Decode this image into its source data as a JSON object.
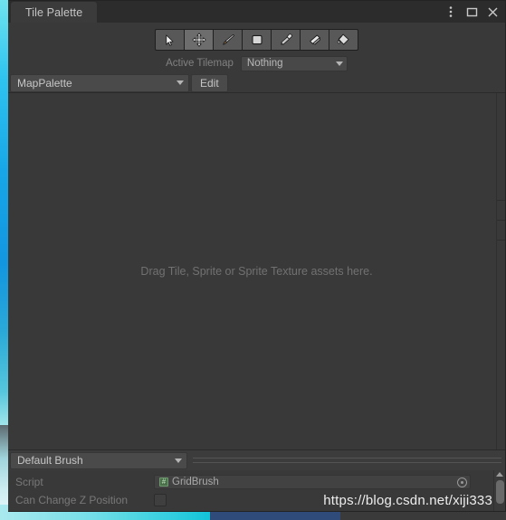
{
  "window": {
    "tab_label": "Tile Palette",
    "controls": [
      {
        "name": "more-menu-icon",
        "glyph": "kebab"
      },
      {
        "name": "maximize-icon",
        "glyph": "square"
      },
      {
        "name": "close-icon",
        "glyph": "cross"
      }
    ]
  },
  "toolbar": {
    "tools": [
      {
        "name": "select-tool",
        "label": "Select",
        "selected": false
      },
      {
        "name": "move-tool",
        "label": "Move",
        "selected": true
      },
      {
        "name": "paint-brush-tool",
        "label": "Paint",
        "selected": false
      },
      {
        "name": "box-fill-tool",
        "label": "Box Fill",
        "selected": false
      },
      {
        "name": "picker-tool",
        "label": "Picker",
        "selected": false
      },
      {
        "name": "eraser-tool",
        "label": "Erase",
        "selected": false
      },
      {
        "name": "fill-tool",
        "label": "Fill",
        "selected": false
      }
    ]
  },
  "active_tilemap": {
    "label": "Active Tilemap",
    "value": "Nothing"
  },
  "palette": {
    "value": "MapPalette",
    "edit_label": "Edit"
  },
  "canvas": {
    "drop_hint": "Drag Tile, Sprite or Sprite Texture assets here."
  },
  "brush": {
    "value": "Default Brush",
    "script_label": "Script",
    "script_value": "GridBrush",
    "script_icon_glyph": "#",
    "z_position_label": "Can Change Z Position",
    "z_position_checked": false
  },
  "watermark": {
    "text": "https://blog.csdn.net/xiji333"
  },
  "colors": {
    "window_bg": "#393939",
    "titlebar_bg": "#2c2c2c",
    "tab_bg": "#3b3b3b",
    "panel_bg": "#3c3c3c",
    "control_bg": "#4a4a4a",
    "tool_bg": "#585858",
    "tool_selected_bg": "#6d6d6d",
    "text": "#c4c4c4",
    "text_disabled": "#787878",
    "accent_cyan": "#2fc4ef",
    "accent_blue": "#2e4b7a",
    "script_green": "#6f9a6f"
  }
}
